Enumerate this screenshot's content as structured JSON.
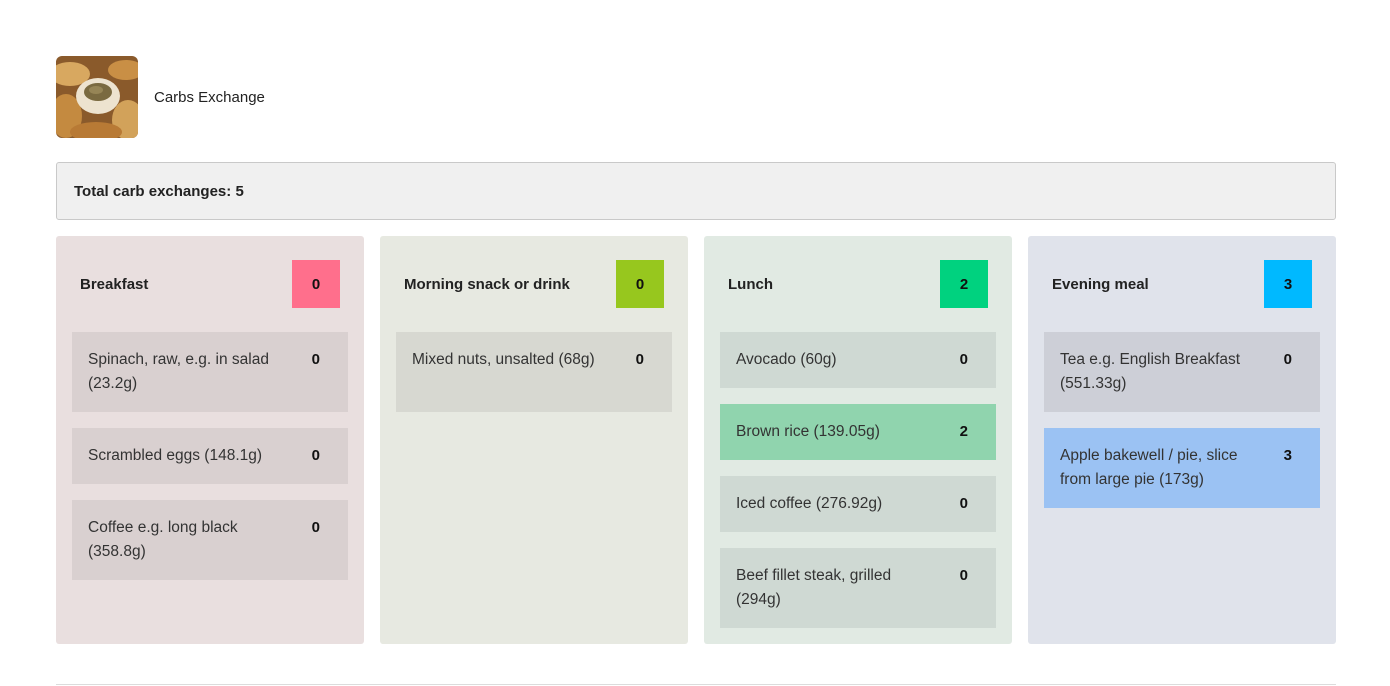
{
  "app": {
    "title": "Carbs Exchange",
    "logo_icon": "bread-basket-icon"
  },
  "summary": {
    "total_label": "Total carb exchanges: 5"
  },
  "meals": [
    {
      "name": "Breakfast",
      "count": "0",
      "colors": {
        "panel": "#e9dfdf",
        "badge": "#ff6f8c",
        "item": "#d9d0d0",
        "item_active": "#d9d0d0"
      },
      "items": [
        {
          "name": "Spinach, raw, e.g. in salad (23.2g)",
          "value": "0"
        },
        {
          "name": "Scrambled eggs (148.1g)",
          "value": "0"
        },
        {
          "name": "Coffee e.g. long black (358.8g)",
          "value": "0"
        }
      ]
    },
    {
      "name": "Morning snack or drink",
      "count": "0",
      "colors": {
        "panel": "#e7e9e1",
        "badge": "#97c71e",
        "item": "#d7d8d1",
        "item_active": "#d7d8d1"
      },
      "items": [
        {
          "name": "Mixed nuts, unsalted (68g)",
          "value": "0"
        }
      ]
    },
    {
      "name": "Lunch",
      "count": "2",
      "colors": {
        "panel": "#e1eae3",
        "badge": "#00d27f",
        "item": "#cfd9d3",
        "item_active": "#90d4ae"
      },
      "items": [
        {
          "name": "Avocado (60g)",
          "value": "0"
        },
        {
          "name": "Brown rice (139.05g)",
          "value": "2"
        },
        {
          "name": "Iced coffee (276.92g)",
          "value": "0"
        },
        {
          "name": "Beef fillet steak, grilled (294g)",
          "value": "0"
        }
      ]
    },
    {
      "name": "Evening meal",
      "count": "3",
      "colors": {
        "panel": "#e0e3eb",
        "badge": "#00b9ff",
        "item": "#cdcfd7",
        "item_active": "#9bc2f3"
      },
      "items": [
        {
          "name": "Tea e.g. English Breakfast (551.33g)",
          "value": "0"
        },
        {
          "name": "Apple bakewell / pie, slice from large pie (173g)",
          "value": "3"
        }
      ]
    }
  ]
}
